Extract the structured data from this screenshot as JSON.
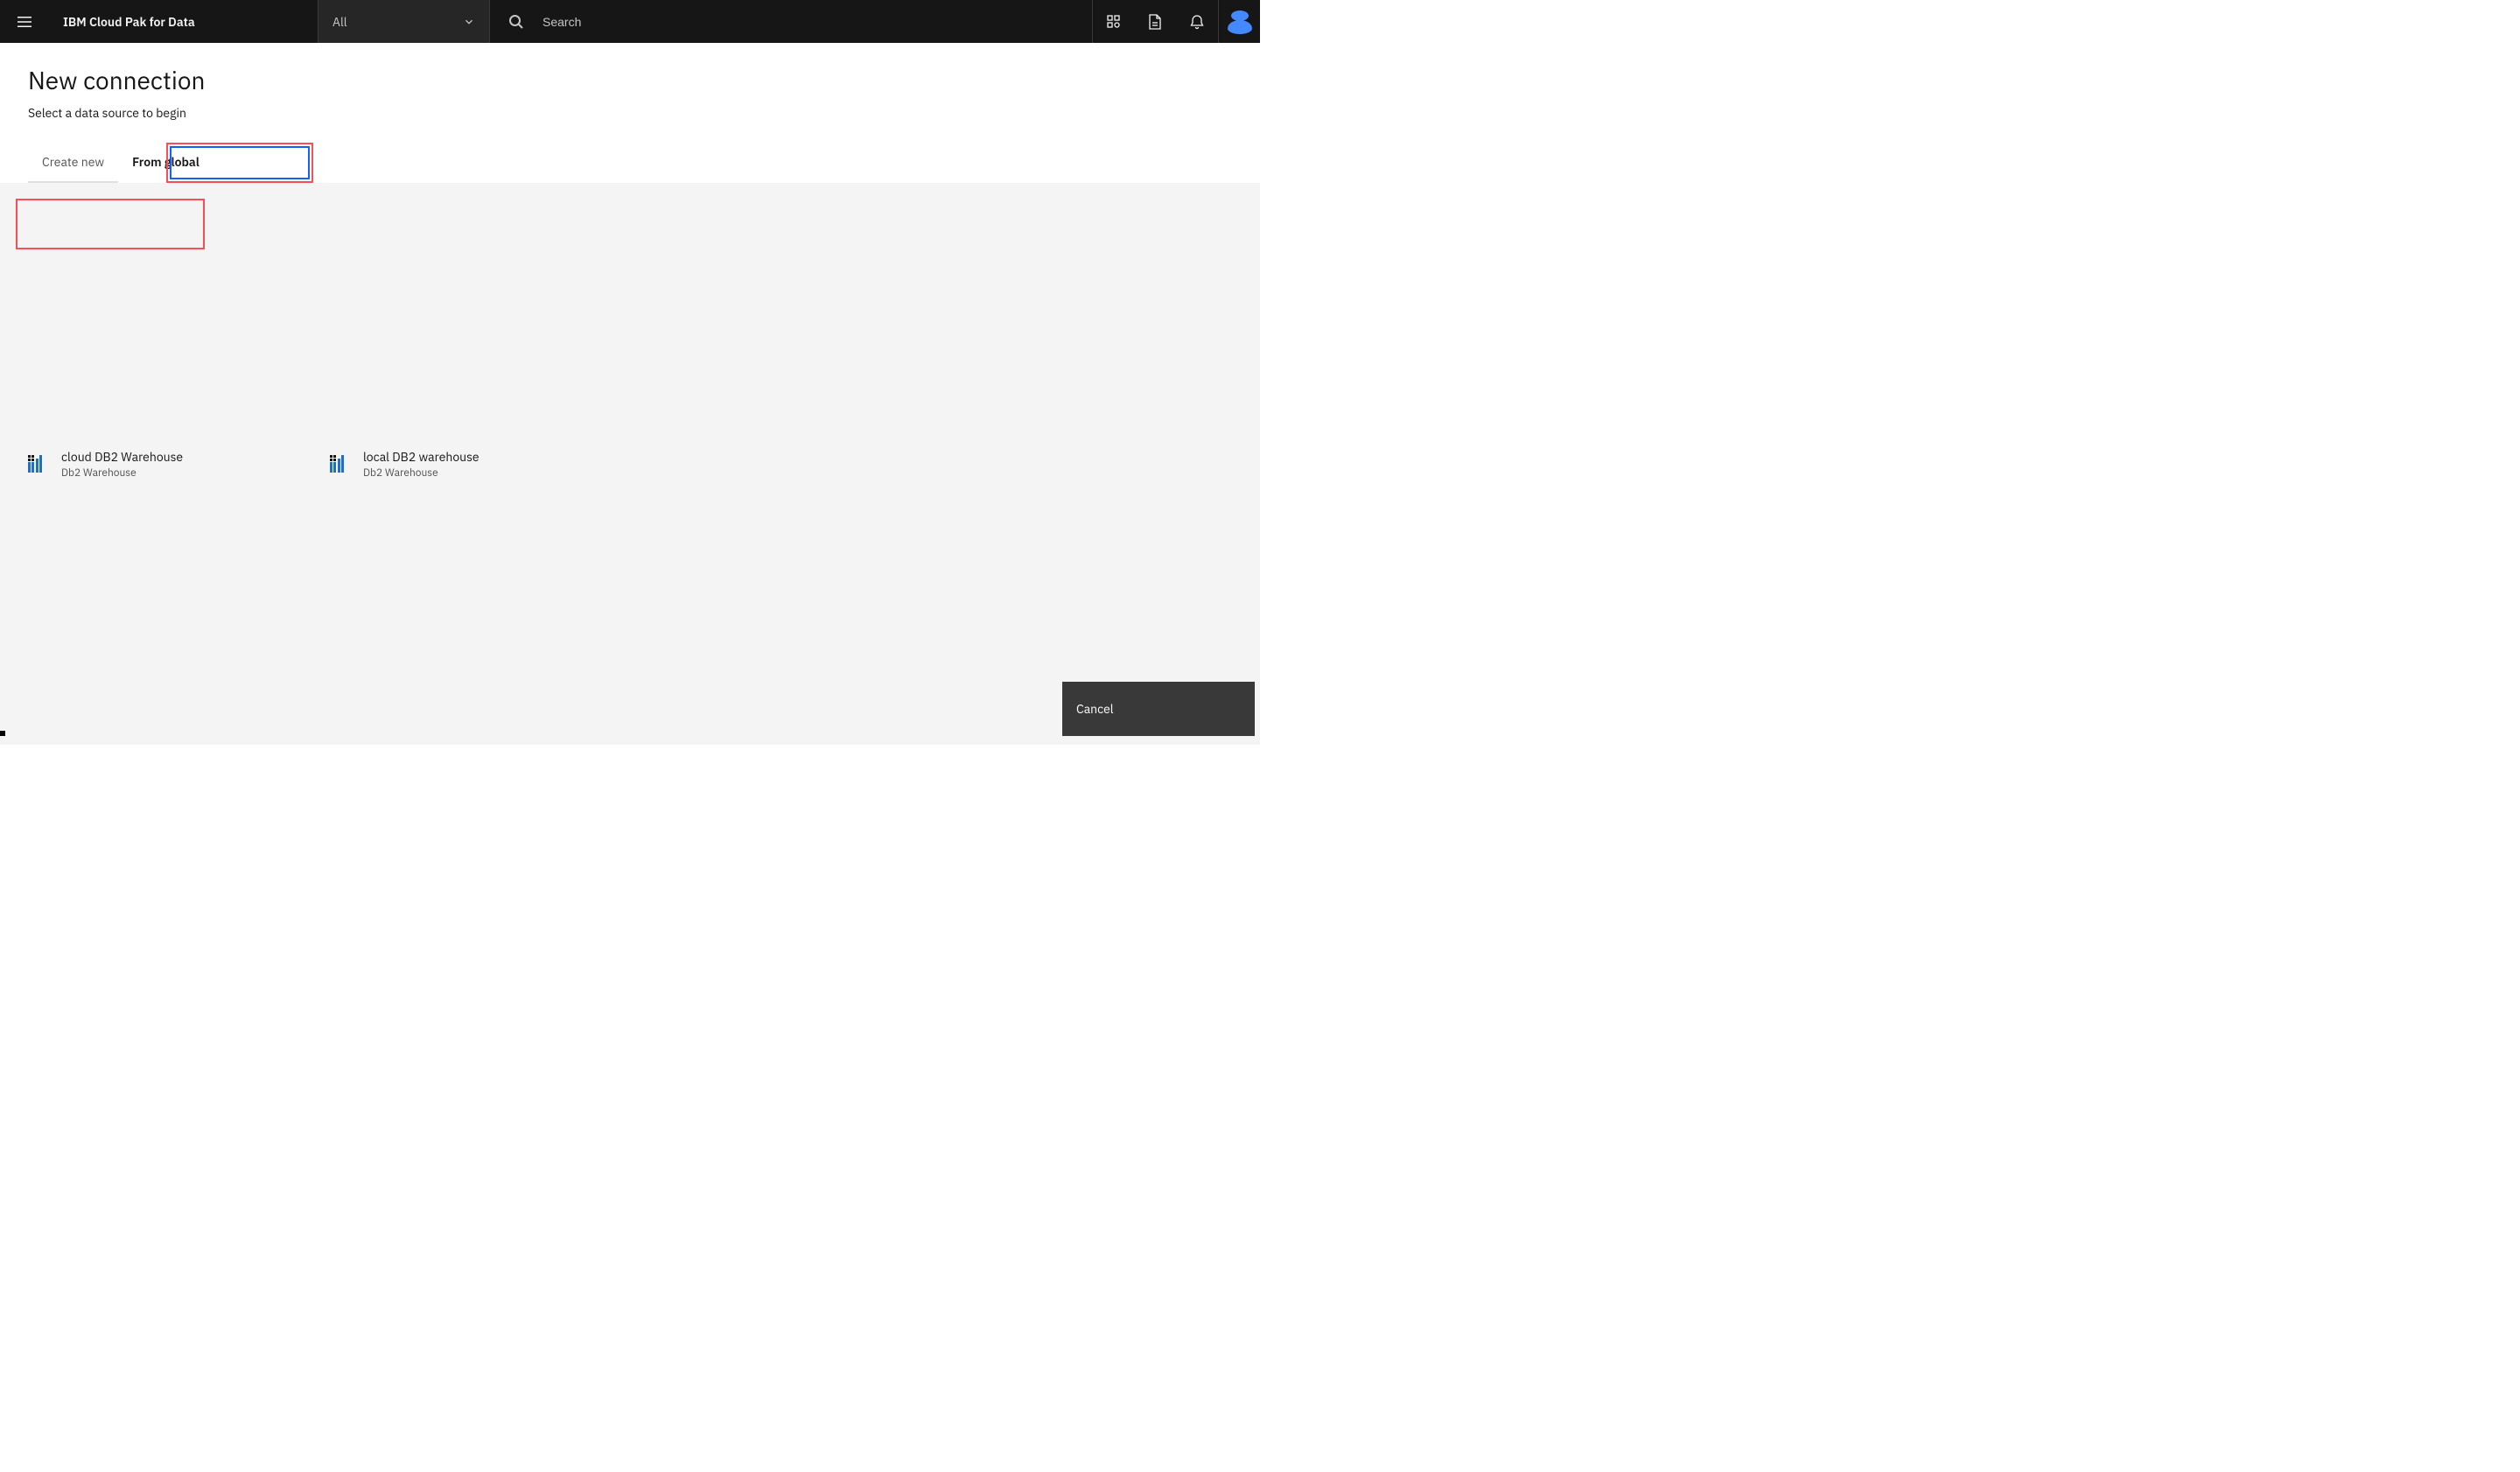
{
  "header": {
    "product_name": "IBM Cloud Pak for Data",
    "dropdown_label": "All",
    "search_placeholder": "Search"
  },
  "page": {
    "title": "New connection",
    "subtitle": "Select a data source to begin"
  },
  "tabs": {
    "create_new": "Create new",
    "from_global": "From global"
  },
  "connections": [
    {
      "name": "cloud DB2 Warehouse",
      "type": "Db2 Warehouse"
    },
    {
      "name": "local DB2 warehouse",
      "type": "Db2 Warehouse"
    }
  ],
  "footer": {
    "cancel": "Cancel"
  }
}
